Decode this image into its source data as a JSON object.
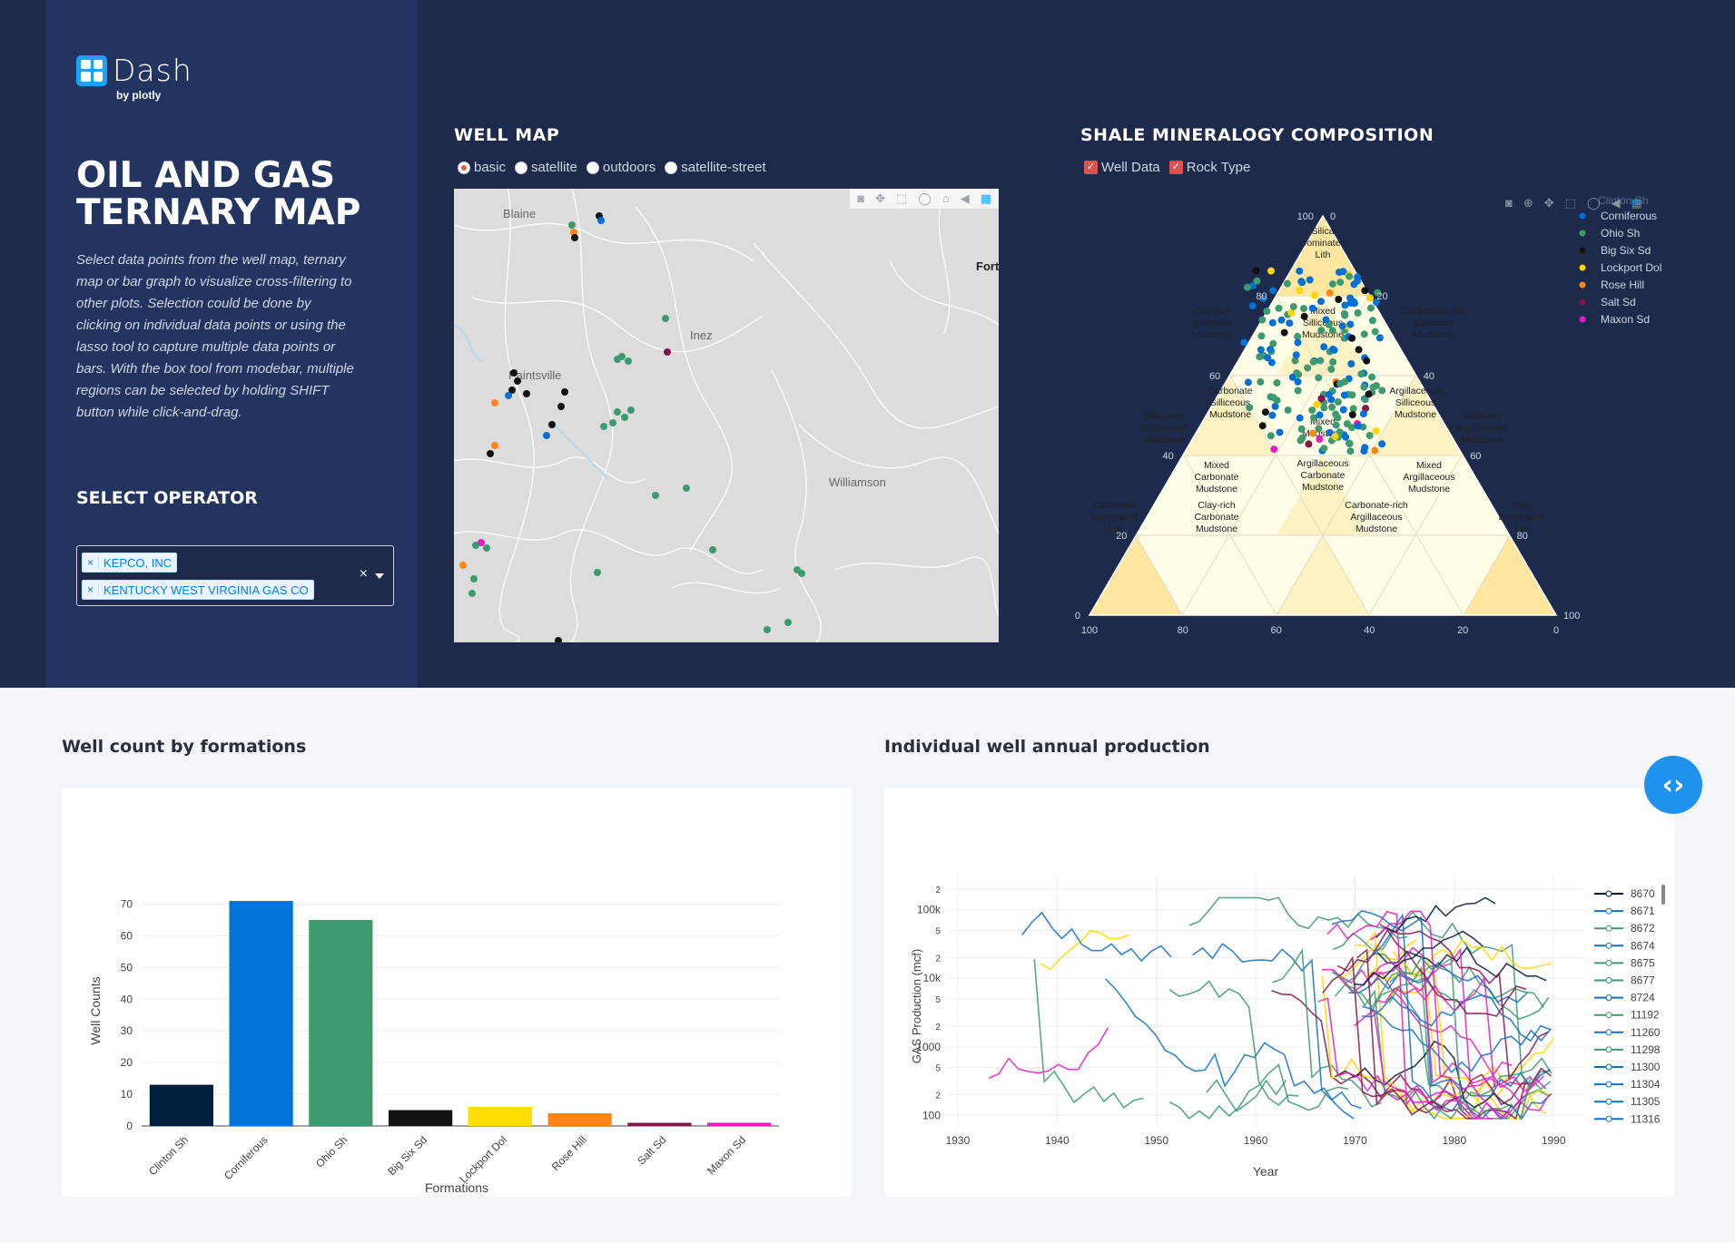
{
  "brand": {
    "name": "Dash",
    "by": "by plotly"
  },
  "sidebar": {
    "title": "OIL AND GAS TERNARY MAP",
    "description": "Select data points from the well map, ternary map or bar graph to visualize cross-filtering to other plots. Selection could be done by clicking on individual data points or using the lasso tool to capture multiple data points or bars. With the box tool from modebar, multiple regions can be selected by holding SHIFT button while click-and-drag.",
    "operator_label": "SELECT OPERATOR",
    "operator_tags": [
      "KEPCO, INC",
      "KENTUCKY WEST VIRGINIA GAS CO"
    ],
    "clear_symbol": "×"
  },
  "well_map": {
    "title": "WELL MAP",
    "styles": [
      "basic",
      "satellite",
      "outdoors",
      "satellite-street"
    ],
    "selected_style": "basic",
    "places": [
      "Blaine",
      "Inez",
      "Paintsville",
      "Williamson",
      "Fort"
    ]
  },
  "ternary": {
    "title": "SHALE MINERALOGY COMPOSITION",
    "toggles": [
      "Well Data",
      "Rock Type"
    ],
    "legend": [
      {
        "name": "Corniferous",
        "color": "#0070d6"
      },
      {
        "name": "Ohio Sh",
        "color": "#3d9970"
      },
      {
        "name": "Big Six Sd",
        "color": "#111111"
      },
      {
        "name": "Lockport Dol",
        "color": "#ffd500"
      },
      {
        "name": "Rose Hill",
        "color": "#ff851b"
      },
      {
        "name": "Salt Sd",
        "color": "#85144b"
      },
      {
        "name": "Maxon Sd",
        "color": "#e31dbf"
      }
    ],
    "legend_overflow": "Clinton Sh",
    "left_axis": [
      "100",
      "80",
      "60",
      "40",
      "20",
      "0"
    ],
    "right_axis": [
      "0",
      "20",
      "40",
      "60",
      "80",
      "100"
    ],
    "bottom_axis": [
      "100",
      "80",
      "60",
      "40",
      "20",
      "0"
    ],
    "regions": [
      "Silica Dominated Lith",
      "Clay rich Silliceous Mudstone",
      "Mixed Silliceous Mudstone",
      "Carbonate rich Silliceous Mudstone",
      "Carbonate Silliceous Mudstone",
      "Argillaceous Silliceous Mudstone",
      "Silica rich Carbonate Mudstone",
      "Mixed Mudstone",
      "Silica rich Argillaceous Mudstone",
      "Mixed Carbonate Mudstone",
      "Mixed Argillaceous Mudstone",
      "Argillaceous Carbonate Mudstone",
      "Carbonate Dominated Lith",
      "Clay-rich Carbonate Mudstone",
      "Carbonate-rich Argillaceous Mudstone",
      "Clay Dominated Lith"
    ]
  },
  "bar_chart_title": "Well count by formations",
  "line_chart_title": "Individual well annual production",
  "chart_data": [
    {
      "type": "bar",
      "title": "Well count by formations",
      "xlabel": "Formations",
      "ylabel": "Well Counts",
      "categories": [
        "Clinton Sh",
        "Corniferous",
        "Ohio Sh",
        "Big Six Sd",
        "Lockport Dol",
        "Rose Hill",
        "Salt Sd",
        "Maxon Sd"
      ],
      "values": [
        13,
        71,
        65,
        5,
        6,
        4,
        1,
        1
      ],
      "colors": [
        "#001f3f",
        "#0074d9",
        "#3d9970",
        "#111111",
        "#ffdc00",
        "#ff851b",
        "#85144b",
        "#e31dbf"
      ],
      "yticks": [
        "0",
        "10",
        "20",
        "30",
        "40",
        "50",
        "60",
        "70"
      ],
      "ylim": [
        0,
        73
      ]
    },
    {
      "type": "line",
      "title": "Individual well annual production",
      "xlabel": "Year",
      "ylabel": "GAS Production (mcf)",
      "xticks": [
        "1930",
        "1940",
        "1950",
        "1960",
        "1970",
        "1980",
        "1990"
      ],
      "yticks": [
        {
          "label": "100",
          "major": true
        },
        {
          "label": "2",
          "major": false
        },
        {
          "label": "5",
          "major": false
        },
        {
          "label": "1000",
          "major": true
        },
        {
          "label": "2",
          "major": false
        },
        {
          "label": "5",
          "major": false
        },
        {
          "label": "10k",
          "major": true
        },
        {
          "label": "2",
          "major": false
        },
        {
          "label": "5",
          "major": false
        },
        {
          "label": "100k",
          "major": true
        },
        {
          "label": "2",
          "major": false
        }
      ],
      "legend": [
        {
          "name": "8670",
          "color": "#0b1a3a"
        },
        {
          "name": "8671",
          "color": "#1170c4"
        },
        {
          "name": "8672",
          "color": "#3d9970"
        },
        {
          "name": "8674",
          "color": "#1170c4"
        },
        {
          "name": "8675",
          "color": "#3d9970"
        },
        {
          "name": "8677",
          "color": "#3d9970"
        },
        {
          "name": "8724",
          "color": "#1170c4"
        },
        {
          "name": "11192",
          "color": "#3d9970"
        },
        {
          "name": "11260",
          "color": "#1170c4"
        },
        {
          "name": "11298",
          "color": "#3d9970"
        },
        {
          "name": "11300",
          "color": "#1170c4"
        },
        {
          "name": "11304",
          "color": "#1170c4"
        },
        {
          "name": "11305",
          "color": "#1170c4"
        },
        {
          "name": "11316",
          "color": "#1170c4"
        }
      ]
    }
  ]
}
